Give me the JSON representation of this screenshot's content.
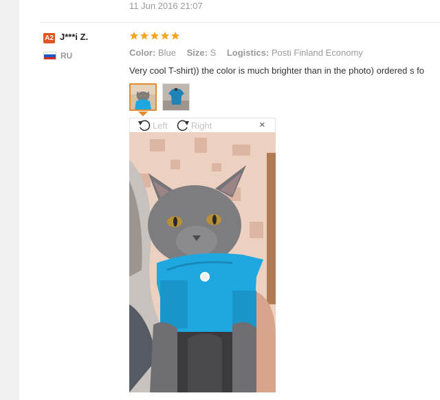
{
  "previous_review": {
    "date": "11 Jun 2016 21:07"
  },
  "review": {
    "level_badge": "A2",
    "user_name": "J***i Z.",
    "country": "RU",
    "rating": {
      "value": 5,
      "max": 5
    },
    "color_label": "Color:",
    "color_value": "Blue",
    "size_label": "Size:",
    "size_value": "S",
    "logistics_label": "Logistics:",
    "logistics_value": "Posti Finland Economy",
    "text": "Very cool T-shirt)) the color is much brighter than in the photo) ordered s fo"
  },
  "viewer": {
    "rotate_left_label": "Left",
    "rotate_right_label": "Right",
    "close_symbol": "×",
    "icons": [
      "rotate-left-icon",
      "rotate-right-icon",
      "close-icon"
    ]
  },
  "colors": {
    "badge": "#e2541f",
    "star": "#f5a623",
    "thumb_active_border": "#e48b2c",
    "shirt": "#1fa8df",
    "cat_fur": "#7d7d80"
  }
}
